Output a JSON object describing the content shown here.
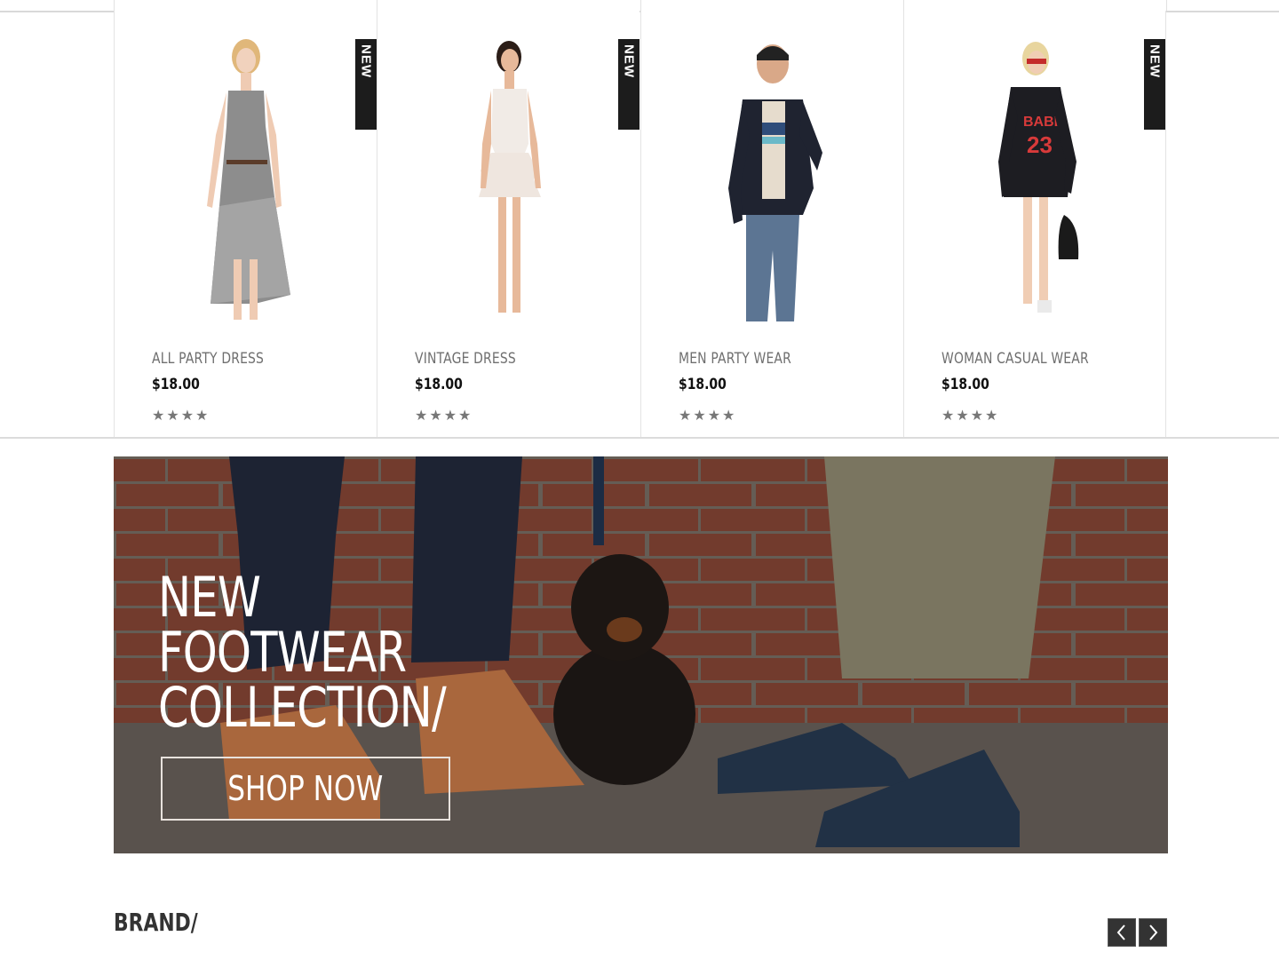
{
  "products": [
    {
      "name": "ALL PARTY DRESS",
      "price": "$18.00",
      "badge": "NEW",
      "rating": "★★★★",
      "image": "woman-striped-dress"
    },
    {
      "name": "VINTAGE DRESS",
      "price": "$18.00",
      "badge": "NEW",
      "rating": "★★★★",
      "image": "woman-white-dress"
    },
    {
      "name": "MEN PARTY WEAR",
      "price": "$18.00",
      "badge": "",
      "rating": "★★★★",
      "image": "man-denim-jacket"
    },
    {
      "name": "WOMAN CASUAL WEAR",
      "price": "$18.00",
      "badge": "NEW",
      "rating": "★★★★",
      "image": "woman-sweatshirt"
    }
  ],
  "banner": {
    "title_lines": [
      "NEW",
      "FOOTWEAR",
      "COLLECTION/"
    ],
    "button_label": "SHOP NOW",
    "image": "dachshund-shoes-brick-wall"
  },
  "brand": {
    "title": "BRAND/",
    "prev_icon": "chevron-left-icon",
    "next_icon": "chevron-right-icon"
  },
  "colors": {
    "badge": "#1c1c1c",
    "text_dark": "#111111",
    "text_muted": "#6f6f6f",
    "nav_button": "#333333"
  }
}
